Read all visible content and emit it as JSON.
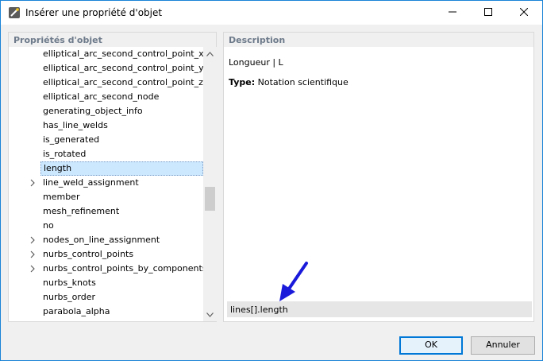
{
  "window": {
    "title": "Insérer une propriété d'objet",
    "icons": {
      "app": "wand-icon",
      "minimize": "minimize-icon",
      "maximize": "maximize-icon",
      "close": "close-icon"
    }
  },
  "left_panel": {
    "header": "Propriétés d'objet",
    "items": [
      {
        "label": "elliptical_arc_second_control_point_x",
        "expandable": false,
        "selected": false
      },
      {
        "label": "elliptical_arc_second_control_point_y",
        "expandable": false,
        "selected": false
      },
      {
        "label": "elliptical_arc_second_control_point_z",
        "expandable": false,
        "selected": false
      },
      {
        "label": "elliptical_arc_second_node",
        "expandable": false,
        "selected": false
      },
      {
        "label": "generating_object_info",
        "expandable": false,
        "selected": false
      },
      {
        "label": "has_line_welds",
        "expandable": false,
        "selected": false
      },
      {
        "label": "is_generated",
        "expandable": false,
        "selected": false
      },
      {
        "label": "is_rotated",
        "expandable": false,
        "selected": false
      },
      {
        "label": "length",
        "expandable": false,
        "selected": true
      },
      {
        "label": "line_weld_assignment",
        "expandable": true,
        "selected": false
      },
      {
        "label": "member",
        "expandable": false,
        "selected": false
      },
      {
        "label": "mesh_refinement",
        "expandable": false,
        "selected": false
      },
      {
        "label": "no",
        "expandable": false,
        "selected": false
      },
      {
        "label": "nodes_on_line_assignment",
        "expandable": true,
        "selected": false
      },
      {
        "label": "nurbs_control_points",
        "expandable": true,
        "selected": false
      },
      {
        "label": "nurbs_control_points_by_components",
        "expandable": true,
        "selected": false
      },
      {
        "label": "nurbs_knots",
        "expandable": false,
        "selected": false
      },
      {
        "label": "nurbs_order",
        "expandable": false,
        "selected": false
      },
      {
        "label": "parabola_alpha",
        "expandable": false,
        "selected": false
      }
    ]
  },
  "right_panel": {
    "header": "Description",
    "description": "Longueur | L",
    "type_label": "Type:",
    "type_value": "Notation scientifique",
    "expression": "lines[].length",
    "arrow_color": "#1a1adb"
  },
  "buttons": {
    "ok": "OK",
    "cancel": "Annuler"
  },
  "colors": {
    "accent": "#0078d7",
    "selection": "#cce8ff",
    "header_text": "#6d7a8a"
  }
}
